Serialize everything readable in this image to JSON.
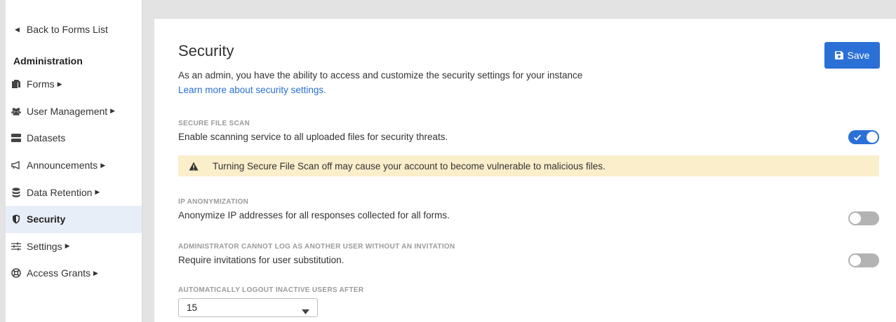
{
  "sidebar": {
    "back_label": "Back to Forms List",
    "heading": "Administration",
    "items": [
      {
        "label": "Forms",
        "icon": "forms-icon"
      },
      {
        "label": "User Management",
        "icon": "users-icon"
      },
      {
        "label": "Datasets",
        "icon": "datasets-icon"
      },
      {
        "label": "Announcements",
        "icon": "megaphone-icon"
      },
      {
        "label": "Data Retention",
        "icon": "database-icon"
      },
      {
        "label": "Security",
        "icon": "shield-icon",
        "active": true
      },
      {
        "label": "Settings",
        "icon": "sliders-icon"
      },
      {
        "label": "Access Grants",
        "icon": "lifering-icon"
      }
    ]
  },
  "main": {
    "title": "Security",
    "save_label": "Save",
    "description": "As an admin, you have the ability to access and customize the security settings for your instance",
    "learn_link": "Learn more about security settings.",
    "sections": {
      "file_scan": {
        "label": "SECURE FILE SCAN",
        "text": "Enable scanning service to all uploaded files for security threats.",
        "enabled": true,
        "warning": "Turning Secure File Scan off may cause your account to become vulnerable to malicious files."
      },
      "ip_anon": {
        "label": "IP ANONYMIZATION",
        "text": "Anonymize IP addresses for all responses collected for all forms.",
        "enabled": false
      },
      "impersonation": {
        "label": "ADMINISTRATOR CANNOT LOG AS ANOTHER USER WITHOUT AN INVITATION",
        "text": "Require invitations for user substitution.",
        "enabled": false
      },
      "logout": {
        "label": "AUTOMATICALLY LOGOUT INACTIVE USERS AFTER",
        "value": "15"
      }
    }
  },
  "colors": {
    "accent": "#2a70d6",
    "link": "#2a6fd1",
    "warning_bg": "#fbeecb",
    "active_nav_bg": "#e8eef7"
  }
}
